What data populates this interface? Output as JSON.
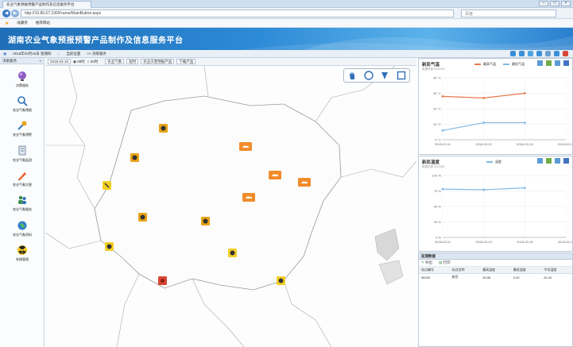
{
  "browser": {
    "tab_title": "农业气象预报预警产品制作及信息服务平台",
    "url": "http://10.86.67.190/Frame/MainButton.aspx",
    "search_placeholder": "百度",
    "favorites": [
      "收藏夹",
      "推荐网站"
    ]
  },
  "app": {
    "title": "湖南农业气象预报预警产品制作及信息服务平台",
    "info_items": [
      "2018年03月15日 星期四",
      "当前位置",
      ">> 决策服务"
    ]
  },
  "sidebar": {
    "header": "决策服务",
    "items": [
      {
        "label": "决策服务",
        "icon": "globe-icon"
      },
      {
        "label": "农业气象预报",
        "icon": "magnifier-icon"
      },
      {
        "label": "农业气象预警",
        "icon": "wrench-icon"
      },
      {
        "label": "农业气象监测",
        "icon": "document-icon"
      },
      {
        "label": "农业气象灾害",
        "icon": "pencil-icon"
      },
      {
        "label": "农业气象服务",
        "icon": "people-icon"
      },
      {
        "label": "农业气象资料",
        "icon": "earth-icon"
      },
      {
        "label": "系统管理",
        "icon": "radiation-icon"
      }
    ]
  },
  "map_toolbar": {
    "date": "2018-03-15",
    "options": [
      "08时",
      "20时"
    ],
    "buttons": [
      "农业气象",
      "短时",
      "农业灾害预报产品",
      "下载产品"
    ]
  },
  "map": {
    "tools": [
      "hand-tool-icon",
      "circle-tool-icon",
      "pin-tool-icon",
      "square-tool-icon"
    ],
    "markers": [
      {
        "type": "sun-cloud",
        "color": "#e8a317"
      },
      {
        "type": "cloud-rain",
        "color": "#f08c2a"
      },
      {
        "type": "cloud-rain",
        "color": "#f08c2a"
      },
      {
        "type": "sun-cloud",
        "color": "#e8a317"
      },
      {
        "type": "sun-cloud",
        "color": "#e8a317"
      },
      {
        "type": "sun-cloud",
        "color": "#e8a317"
      },
      {
        "type": "sun-cloud",
        "color": "#e8a317"
      },
      {
        "type": "sun-cloud",
        "color": "#e8a317"
      },
      {
        "type": "sun-cloud",
        "color": "#e8a317"
      },
      {
        "type": "sun-cloud",
        "color": "#e8a317"
      },
      {
        "type": "sun-cloud",
        "color": "#d84532"
      },
      {
        "type": "cloud-rain",
        "color": "#f08c2a"
      },
      {
        "type": "cloud-rain",
        "color": "#f08c2a"
      }
    ]
  },
  "chart_data": [
    {
      "type": "line",
      "title": "新民气温",
      "subtitle": "数据来源 5320000",
      "x": [
        "2018-03-11",
        "2018-03-13",
        "2018-03-15",
        "2018-03-17"
      ],
      "series": [
        {
          "name": "最高气温",
          "color": "#e87a4c",
          "values": [
            28,
            27,
            30,
            null
          ]
        },
        {
          "name": "最低气温",
          "color": "#7fb9e6",
          "values": [
            6,
            11,
            11,
            null
          ]
        }
      ],
      "yticks": [
        "0 °C",
        "10 °C",
        "20 °C",
        "30 °C",
        "40 °C"
      ],
      "ylim": [
        0,
        40
      ]
    },
    {
      "type": "line",
      "title": "新民湿度",
      "subtitle": "数据来源 5320000",
      "x": [
        "2018-03-11",
        "2018-03-13",
        "2018-03-15",
        "2018-03-17"
      ],
      "series": [
        {
          "name": "湿度",
          "color": "#7fb9e6",
          "values": [
            78,
            77,
            80,
            null
          ]
        }
      ],
      "yticks": [
        "0 %",
        "25 %",
        "50 %",
        "75 %",
        "100 %"
      ],
      "ylim": [
        0,
        100
      ]
    }
  ],
  "table_panel": {
    "header": "监测数据",
    "tools": [
      "导出",
      "打印"
    ],
    "columns": [
      "站点编号",
      "站点名称",
      "最高温度",
      "最低温度",
      "平均湿度"
    ],
    "rows": [
      [
        "58433",
        "新民",
        "28.88",
        "5.00",
        "81.00"
      ]
    ]
  }
}
